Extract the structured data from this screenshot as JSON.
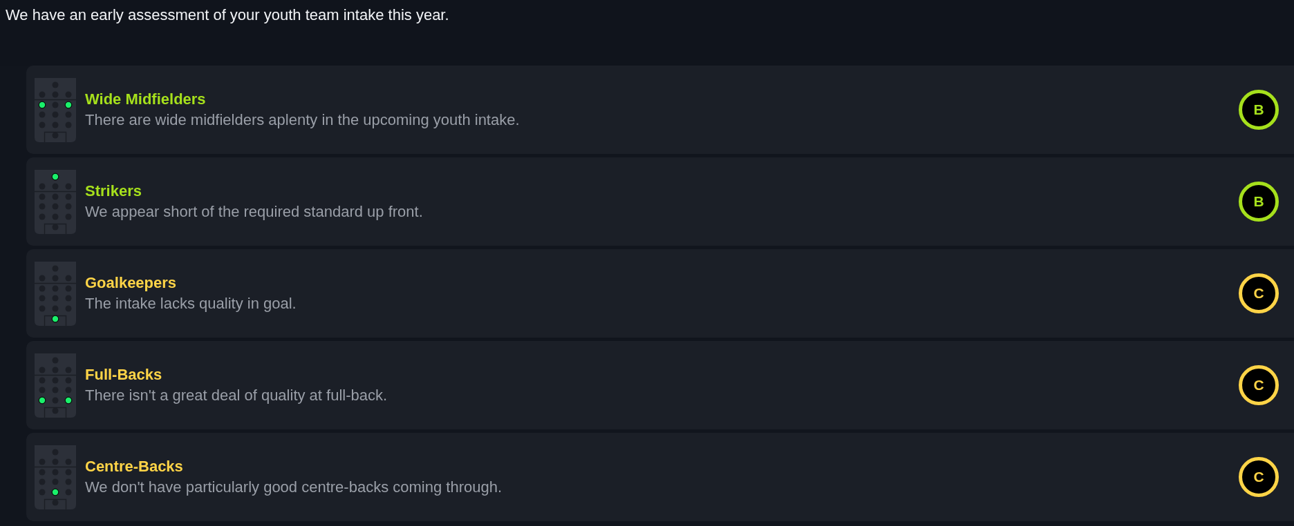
{
  "message": "We have an early assessment of your youth team intake this year.",
  "items": [
    {
      "title": "Wide Midfielders",
      "description": "There are wide midfielders aplenty in the upcoming youth intake.",
      "grade": "B",
      "color": "#a6e01c",
      "pitch_rows": [
        [
          {
            "on": false
          }
        ],
        [
          {
            "on": false
          },
          {
            "on": false
          },
          {
            "on": false
          }
        ],
        [
          {
            "on": true
          },
          {
            "on": false
          },
          {
            "on": true
          }
        ],
        [
          {
            "on": false
          },
          {
            "on": false
          },
          {
            "on": false
          }
        ],
        [
          {
            "on": false
          },
          {
            "on": false
          },
          {
            "on": false
          }
        ],
        [
          {
            "on": false
          }
        ]
      ]
    },
    {
      "title": "Strikers",
      "description": "We appear short of the required standard up front.",
      "grade": "B",
      "color": "#a6e01c",
      "pitch_rows": [
        [
          {
            "on": true
          }
        ],
        [
          {
            "on": false
          },
          {
            "on": false
          },
          {
            "on": false
          }
        ],
        [
          {
            "on": false
          },
          {
            "on": false
          },
          {
            "on": false
          }
        ],
        [
          {
            "on": false
          },
          {
            "on": false
          },
          {
            "on": false
          }
        ],
        [
          {
            "on": false
          },
          {
            "on": false
          },
          {
            "on": false
          }
        ],
        [
          {
            "on": false
          }
        ]
      ]
    },
    {
      "title": "Goalkeepers",
      "description": "The intake lacks quality in goal.",
      "grade": "C",
      "color": "#ffd447",
      "pitch_rows": [
        [
          {
            "on": false
          }
        ],
        [
          {
            "on": false
          },
          {
            "on": false
          },
          {
            "on": false
          }
        ],
        [
          {
            "on": false
          },
          {
            "on": false
          },
          {
            "on": false
          }
        ],
        [
          {
            "on": false
          },
          {
            "on": false
          },
          {
            "on": false
          }
        ],
        [
          {
            "on": false
          },
          {
            "on": false
          },
          {
            "on": false
          }
        ],
        [
          {
            "on": true
          }
        ]
      ]
    },
    {
      "title": "Full-Backs",
      "description": "There isn't a great deal of quality at full-back.",
      "grade": "C",
      "color": "#ffd447",
      "pitch_rows": [
        [
          {
            "on": false
          }
        ],
        [
          {
            "on": false
          },
          {
            "on": false
          },
          {
            "on": false
          }
        ],
        [
          {
            "on": false
          },
          {
            "on": false
          },
          {
            "on": false
          }
        ],
        [
          {
            "on": false
          },
          {
            "on": false
          },
          {
            "on": false
          }
        ],
        [
          {
            "on": true
          },
          {
            "on": false
          },
          {
            "on": true
          }
        ],
        [
          {
            "on": false
          }
        ]
      ]
    },
    {
      "title": "Centre-Backs",
      "description": "We don't have particularly good centre-backs coming through.",
      "grade": "C",
      "color": "#ffd447",
      "pitch_rows": [
        [
          {
            "on": false
          }
        ],
        [
          {
            "on": false
          },
          {
            "on": false
          },
          {
            "on": false
          }
        ],
        [
          {
            "on": false
          },
          {
            "on": false
          },
          {
            "on": false
          }
        ],
        [
          {
            "on": false
          },
          {
            "on": false
          },
          {
            "on": false
          }
        ],
        [
          {
            "on": false
          },
          {
            "on": true
          },
          {
            "on": false
          }
        ],
        [
          {
            "on": false
          }
        ]
      ]
    }
  ]
}
